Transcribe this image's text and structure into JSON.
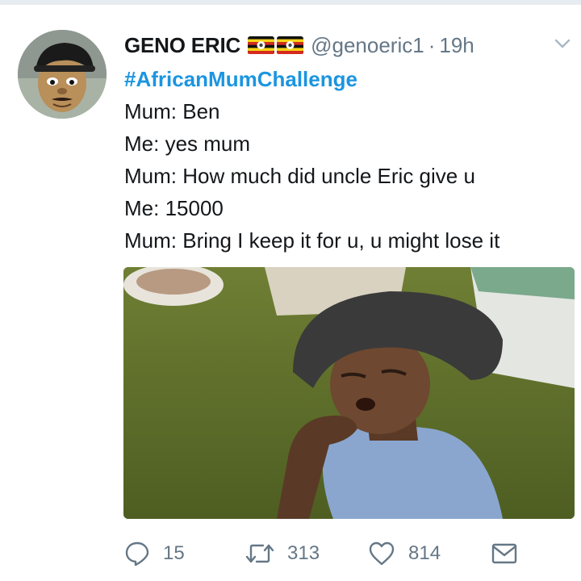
{
  "tweet": {
    "author": {
      "name": "GENO ERIC",
      "handle": "@genoeric1",
      "separator": "·",
      "time": "19h",
      "flags": [
        "uganda-flag-icon",
        "uganda-flag-icon"
      ]
    },
    "hashtag": "#AfricanMumChallenge",
    "lines": [
      "Mum: Ben",
      "Me: yes mum",
      "Mum: How much did uncle Eric give u",
      "Me: 15000",
      "Mum: Bring I keep it for u, u might lose it"
    ],
    "media": {
      "icon": "photo-woman-with-head-wrap"
    },
    "actions": {
      "reply": {
        "icon": "reply-icon",
        "count": "15"
      },
      "retweet": {
        "icon": "retweet-icon",
        "count": "313"
      },
      "like": {
        "icon": "heart-icon",
        "count": "814"
      },
      "dm": {
        "icon": "envelope-icon"
      }
    }
  },
  "colors": {
    "link": "#1b95e0",
    "secondary_text": "#657786",
    "primary_text": "#14171a"
  }
}
